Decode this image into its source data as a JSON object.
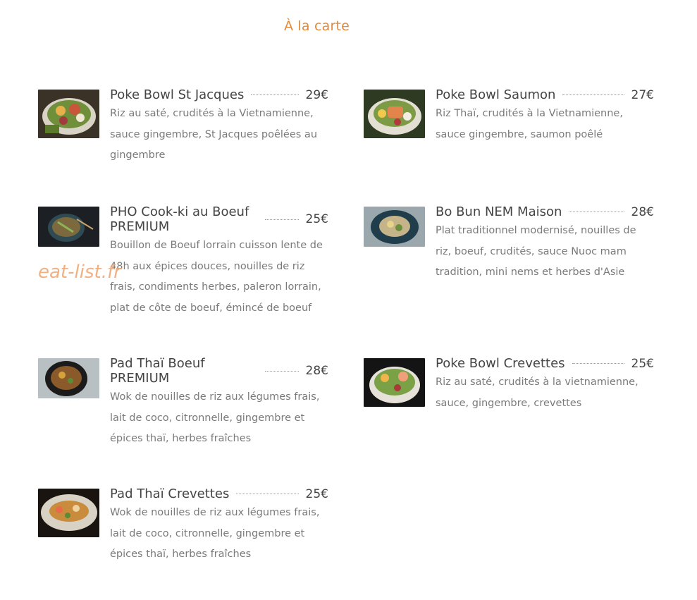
{
  "section_title": "À la carte",
  "watermark": "eat-list.fr",
  "items": [
    {
      "name": "Poke Bowl St Jacques",
      "price": "29€",
      "description": "Riz au saté, crudités à la Vietnamienne, sauce gingembre, St Jacques poêlées au gingembre"
    },
    {
      "name": "Poke Bowl Saumon",
      "price": "27€",
      "description": "Riz Thaï, crudités à la Vietnamienne, sauce gingembre, saumon poêlé"
    },
    {
      "name": "PHO Cook-ki au Boeuf PREMIUM",
      "price": "25€",
      "description": "Bouillon de Boeuf lorrain cuisson lente de 48h aux épices douces, nouilles de riz frais, condiments herbes, paleron lorrain, plat de côte de boeuf, émincé de boeuf"
    },
    {
      "name": "Bo Bun NEM Maison",
      "price": "28€",
      "description": "Plat traditionnel modernisé, nouilles de riz, boeuf, crudités, sauce Nuoc mam tradition, mini nems et herbes d'Asie"
    },
    {
      "name": "Pad Thaï Boeuf PREMIUM",
      "price": "28€",
      "description": "Wok de nouilles de riz aux légumes frais, lait de coco, citronnelle, gingembre et épices thaï, herbes fraîches"
    },
    {
      "name": "Poke Bowl Crevettes",
      "price": "25€",
      "description": "Riz au saté, crudités à la vietnamienne, sauce, gingembre, crevettes"
    },
    {
      "name": "Pad Thaï Crevettes",
      "price": "25€",
      "description": "Wok de nouilles de riz aux légumes frais, lait de coco, citronnelle, gingembre et épices thaï, herbes fraîches"
    }
  ]
}
